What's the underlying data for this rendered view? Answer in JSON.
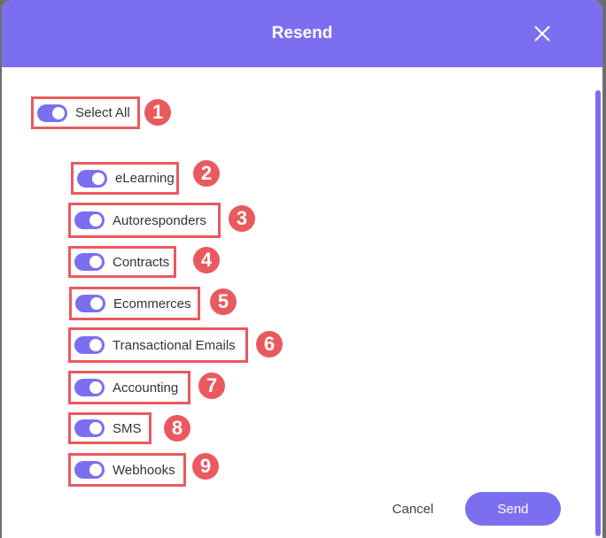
{
  "dialog": {
    "title": "Resend",
    "cancel_label": "Cancel",
    "send_label": "Send"
  },
  "select_all": {
    "label": "Select All",
    "on": true,
    "badge": "1"
  },
  "items": [
    {
      "label": "eLearning",
      "on": true,
      "badge": "2"
    },
    {
      "label": "Autoresponders",
      "on": true,
      "badge": "3"
    },
    {
      "label": "Contracts",
      "on": true,
      "badge": "4"
    },
    {
      "label": "Ecommerces",
      "on": true,
      "badge": "5"
    },
    {
      "label": "Transactional Emails",
      "on": true,
      "badge": "6"
    },
    {
      "label": "Accounting",
      "on": true,
      "badge": "7"
    },
    {
      "label": "SMS",
      "on": true,
      "badge": "8"
    },
    {
      "label": "Webhooks",
      "on": true,
      "badge": "9"
    }
  ],
  "colors": {
    "accent": "#7b6ff0",
    "annotation": "#e95a5f"
  },
  "icons": {
    "close": "close-icon"
  }
}
